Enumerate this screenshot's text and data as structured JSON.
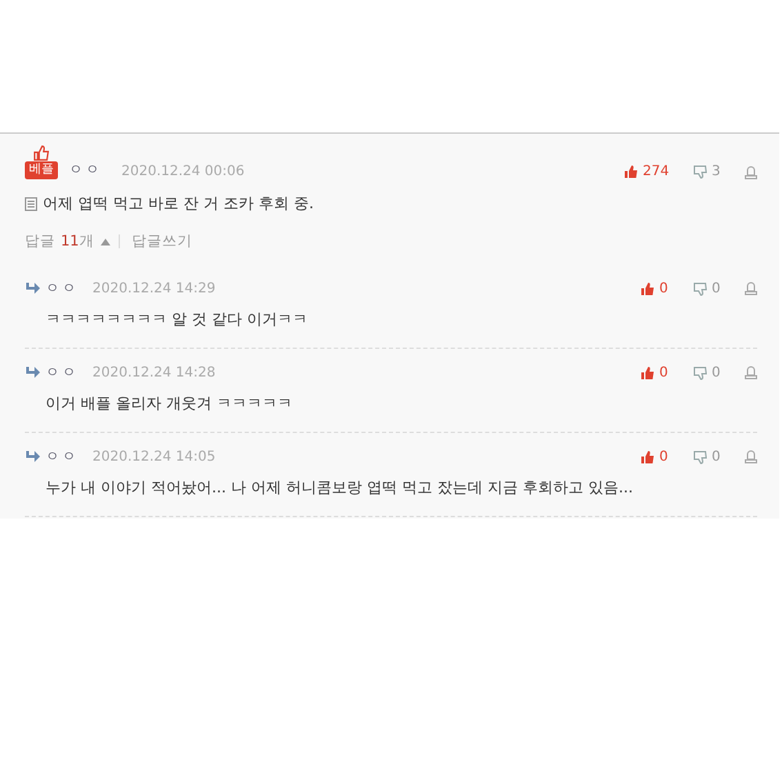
{
  "best_comment": {
    "badge": "베플",
    "author": "ㅇㅇ",
    "date": "2020.12.24 00:06",
    "likes": "274",
    "dislikes": "3",
    "text": "어제 엽떡 먹고 바로 잔 거 조카 후회 중.",
    "reply_label": "답글",
    "reply_count": "11",
    "reply_unit": "개",
    "replies_expanded": true,
    "write_reply": "답글쓰기"
  },
  "replies": [
    {
      "author": "ㅇㅇ",
      "date": "2020.12.24 14:29",
      "likes": "0",
      "dislikes": "0",
      "text": "ㅋㅋㅋㅋㅋㅋㅋㅋ 알 것 같다 이거ㅋㅋ"
    },
    {
      "author": "ㅇㅇ",
      "date": "2020.12.24 14:28",
      "likes": "0",
      "dislikes": "0",
      "text": "이거 배플 올리자 개웃겨 ㅋㅋㅋㅋㅋ"
    },
    {
      "author": "ㅇㅇ",
      "date": "2020.12.24 14:05",
      "likes": "0",
      "dislikes": "0",
      "text": "누가 내 이야기 적어놨어... 나 어제 허니콤보랑 엽떡 먹고 잤는데 지금 후회하고 있음..."
    }
  ]
}
